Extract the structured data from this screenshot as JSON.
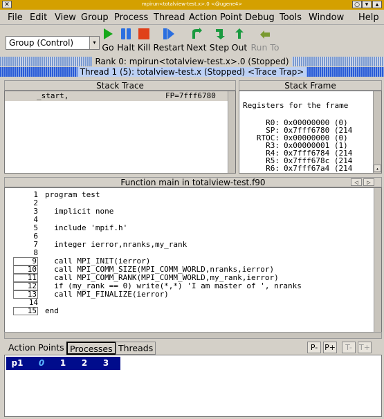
{
  "window": {
    "title": "mpirun<totalview-test.x>.0 <@ugene4>"
  },
  "menu": [
    "File",
    "Edit",
    "View",
    "Group",
    "Process",
    "Thread",
    "Action Point",
    "Debug",
    "Tools",
    "Window",
    "Help"
  ],
  "toolbar": {
    "group_select": "Group (Control)",
    "buttons": [
      {
        "label": "Go",
        "icon": "play-icon",
        "color": "#16a81a"
      },
      {
        "label": "Halt",
        "icon": "pause-icon",
        "color": "#2b6fe0"
      },
      {
        "label": "Kill",
        "icon": "stop-icon",
        "color": "#e0401a"
      },
      {
        "label": "Restart",
        "icon": "restart-icon",
        "color": "#2b6fe0"
      },
      {
        "label": "Next",
        "icon": "next-icon",
        "color": "#1a9a40"
      },
      {
        "label": "Step",
        "icon": "step-icon",
        "color": "#1a9a40"
      },
      {
        "label": "Out",
        "icon": "out-icon",
        "color": "#1a9a40"
      },
      {
        "label": "Run To",
        "icon": "run-to-icon",
        "color": "#7a9a30"
      }
    ]
  },
  "status": {
    "rank": "Rank 0: mpirun<totalview-test.x>.0 (Stopped)",
    "thread": "Thread 1 (5): totalview-test.x (Stopped) <Trace Trap>"
  },
  "stack_trace": {
    "title": "Stack Trace",
    "frames": [
      {
        "name": "_start,",
        "fp": "FP=7fff6780"
      }
    ]
  },
  "stack_frame": {
    "title": "Stack Frame",
    "header": "Registers for the frame",
    "registers": [
      {
        "name": "R0:",
        "value": "0x00000000 (0)"
      },
      {
        "name": "SP:",
        "value": "0x7fff6780 (214"
      },
      {
        "name": "RTOC:",
        "value": "0x00000000 (0)"
      },
      {
        "name": "R3:",
        "value": "0x00000001 (1)"
      },
      {
        "name": "R4:",
        "value": "0x7fff6784 (214"
      },
      {
        "name": "R5:",
        "value": "0x7fff678c (214"
      },
      {
        "name": "R6:",
        "value": "0x7fff67a4 (214"
      }
    ]
  },
  "source": {
    "title": "Function main in totalview-test.f90",
    "lines": [
      {
        "n": "1",
        "t": "program test",
        "box": false
      },
      {
        "n": "2",
        "t": "",
        "box": false
      },
      {
        "n": "3",
        "t": "  implicit none",
        "box": false
      },
      {
        "n": "4",
        "t": "",
        "box": false
      },
      {
        "n": "5",
        "t": "  include 'mpif.h'",
        "box": false
      },
      {
        "n": "6",
        "t": "",
        "box": false
      },
      {
        "n": "7",
        "t": "  integer ierror,nranks,my_rank",
        "box": false
      },
      {
        "n": "8",
        "t": "",
        "box": false
      },
      {
        "n": "9",
        "t": "  call MPI_INIT(ierror)",
        "box": true
      },
      {
        "n": "10",
        "t": "  call MPI_COMM_SIZE(MPI_COMM_WORLD,nranks,ierror)",
        "box": true
      },
      {
        "n": "11",
        "t": "  call MPI_COMM_RANK(MPI_COMM_WORLD,my_rank,ierror)",
        "box": true
      },
      {
        "n": "12",
        "t": "  if (my_rank == 0) write(*,*) 'I am master of ', nranks",
        "box": true
      },
      {
        "n": "13",
        "t": "  call MPI_FINALIZE(ierror)",
        "box": true
      },
      {
        "n": "14",
        "t": "",
        "box": false
      },
      {
        "n": "15",
        "t": "end",
        "box": true
      }
    ]
  },
  "tabs": [
    "Action Points",
    "Processes",
    "Threads"
  ],
  "tab_buttons": [
    "P-",
    "P+",
    "T-",
    "T+"
  ],
  "processes": {
    "label": "p1",
    "ranks": [
      {
        "r": "0",
        "color": "#5ab4ff",
        "italic": true
      },
      {
        "r": "1",
        "color": "#ffffff",
        "italic": false
      },
      {
        "r": "2",
        "color": "#ffffff",
        "italic": false
      },
      {
        "r": "3",
        "color": "#ffffff",
        "italic": false
      }
    ]
  },
  "colors": {
    "process_bg": "#000c8c",
    "thread_bar": "#2a5bd6",
    "title_bar": "#d4a000"
  }
}
